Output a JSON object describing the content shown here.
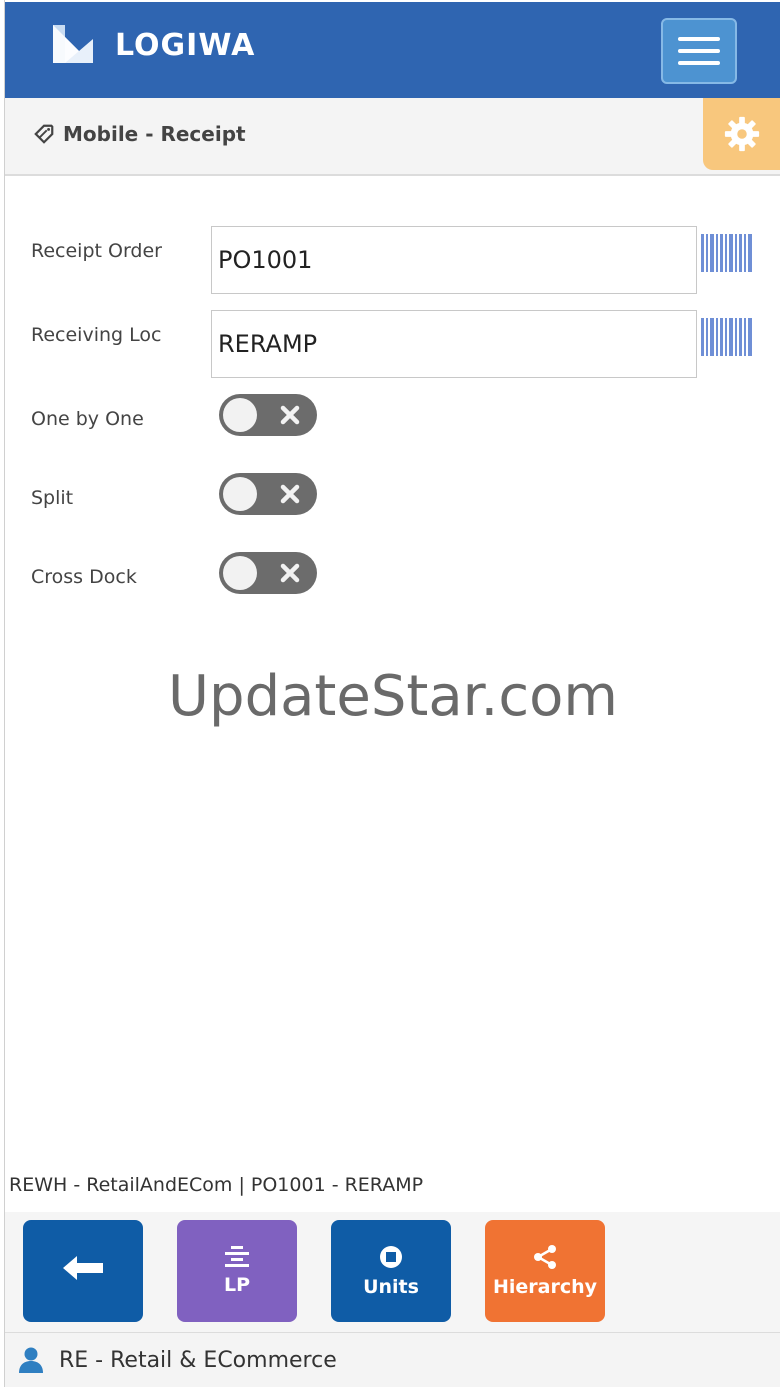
{
  "header": {
    "brand": "LOGIWA",
    "menu_icon": "hamburger-icon"
  },
  "breadcrumb": {
    "icon": "tag-icon",
    "title": "Mobile - Receipt",
    "settings_icon": "gear-icon"
  },
  "form": {
    "receipt_order": {
      "label": "Receipt Order",
      "value": "PO1001"
    },
    "receiving_loc": {
      "label": "Receiving Loc",
      "value": "RERAMP"
    },
    "one_by_one": {
      "label": "One by One",
      "on": false
    },
    "split": {
      "label": "Split",
      "on": false
    },
    "cross_dock": {
      "label": "Cross Dock",
      "on": false
    }
  },
  "watermark": "UpdateStar.com",
  "status_line": "REWH - RetailAndECom | PO1001 - RERAMP",
  "actions": {
    "back_icon": "arrow-left-icon",
    "lp_label": "LP",
    "units_label": "Units",
    "hierarchy_label": "Hierarchy"
  },
  "footer": {
    "user_icon": "user-icon",
    "company": "RE - Retail & ECommerce"
  },
  "colors": {
    "header": "#2f65b1",
    "settings": "#f8c77d",
    "back": "#0f5ca6",
    "lp": "#8061c0",
    "units": "#0f5ca6",
    "hierarchy": "#f07333"
  }
}
